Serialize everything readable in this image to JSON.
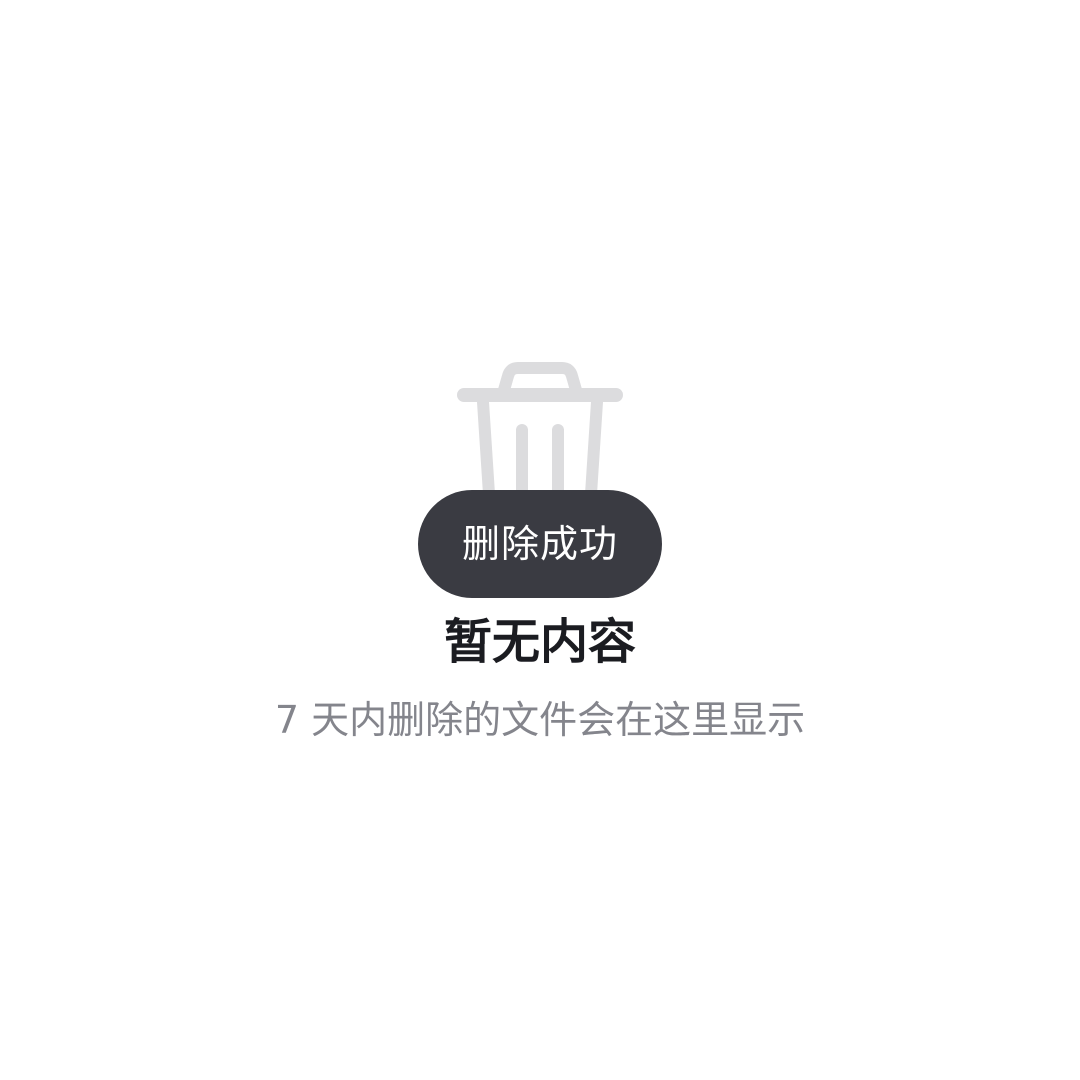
{
  "toast": {
    "message": "删除成功"
  },
  "empty_state": {
    "icon": "trash-icon",
    "title": "暂无内容",
    "subtitle": "7 天内删除的文件会在这里显示"
  },
  "colors": {
    "icon": "#dcdcde",
    "toast_bg": "#3a3b42",
    "toast_text": "#ffffff",
    "title": "#1b1c21",
    "subtitle": "#84858c"
  }
}
